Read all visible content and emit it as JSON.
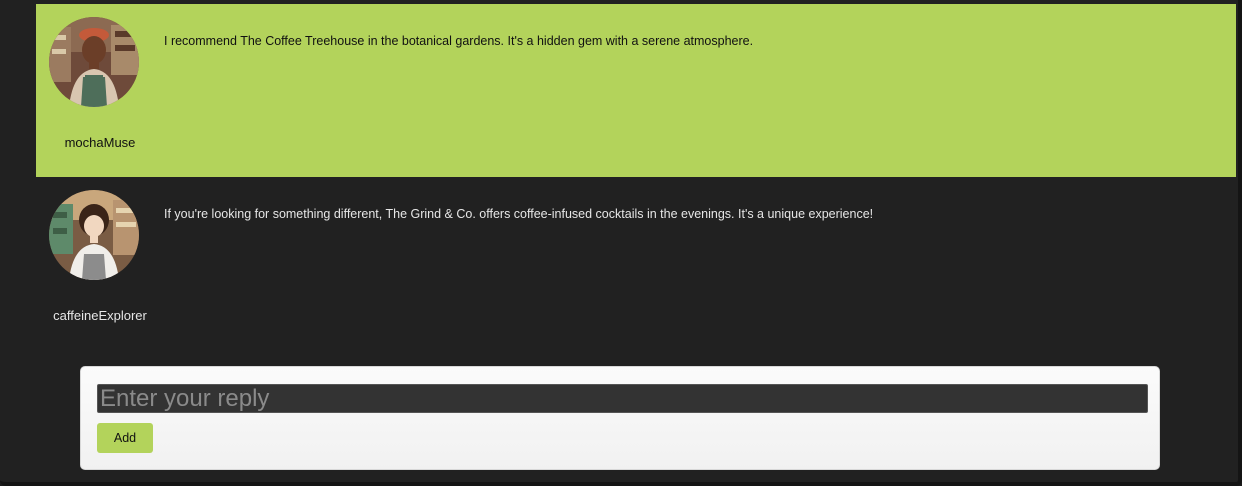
{
  "comments": [
    {
      "username": "mochaMuse",
      "text": "I recommend The Coffee Treehouse in the botanical gardens. It's a hidden gem with a serene atmosphere.",
      "avatar_icon": "barista-woman-avatar",
      "highlighted": true
    },
    {
      "username": "caffeineExplorer",
      "text": "If you're looking for something different, The Grind & Co. offers coffee-infused cocktails in the evenings. It's a unique experience!",
      "avatar_icon": "barista-anime-avatar",
      "highlighted": false
    }
  ],
  "reply": {
    "placeholder": "Enter your reply",
    "value": "",
    "add_label": "Add"
  },
  "colors": {
    "accent": "#b3d35b",
    "background": "#212121",
    "input_bg": "#333333"
  }
}
